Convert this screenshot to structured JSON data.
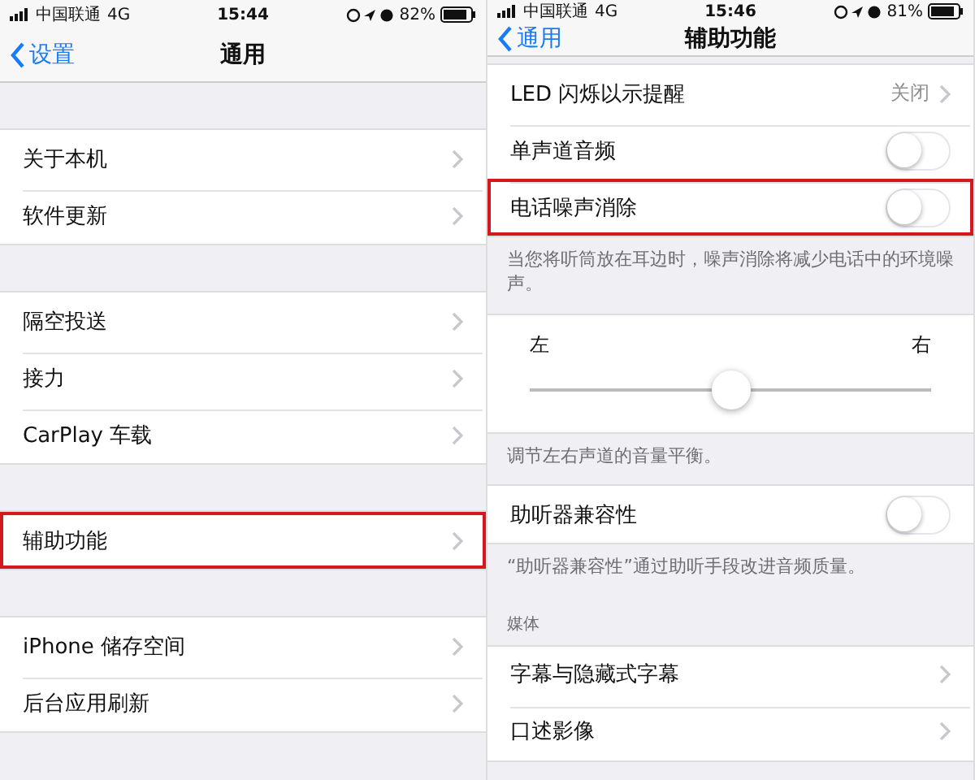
{
  "panels": [
    {
      "status_bar": {
        "carrier": "中国联通",
        "network": "4G",
        "time": "15:44",
        "battery": "82%"
      },
      "nav": {
        "back": "设置",
        "title": "通用"
      },
      "groups": [
        {
          "items": [
            {
              "kind": "link",
              "label": "关于本机",
              "highlighted": false
            },
            {
              "kind": "link",
              "label": "软件更新",
              "highlighted": false
            }
          ]
        },
        {
          "items": [
            {
              "kind": "link",
              "label": "隔空投送",
              "highlighted": false
            },
            {
              "kind": "link",
              "label": "接力",
              "highlighted": false
            },
            {
              "kind": "link",
              "label": "CarPlay 车载",
              "highlighted": false
            }
          ]
        },
        {
          "items": [
            {
              "kind": "link",
              "label": "辅助功能",
              "highlighted": true
            }
          ]
        },
        {
          "items": [
            {
              "kind": "link",
              "label": "iPhone 储存空间",
              "highlighted": false
            },
            {
              "kind": "link",
              "label": "后台应用刷新",
              "highlighted": false
            }
          ]
        }
      ]
    },
    {
      "status_bar": {
        "carrier": "中国联通",
        "network": "4G",
        "time": "15:46",
        "battery": "81%"
      },
      "nav": {
        "back": "通用",
        "title": "辅助功能"
      },
      "groups": [
        {
          "items": [
            {
              "kind": "value",
              "label": "LED 闪烁以示提醒",
              "value": "关闭",
              "highlighted": false
            },
            {
              "kind": "switch",
              "label": "单声道音频",
              "on": false,
              "highlighted": false
            },
            {
              "kind": "switch",
              "label": "电话噪声消除",
              "on": false,
              "highlighted": true
            }
          ],
          "footer": "当您将听筒放在耳边时，噪声消除将减少电话中的环境噪声。"
        },
        {
          "items": [
            {
              "kind": "balance",
              "left": "左",
              "right": "右",
              "level": 0.5
            }
          ],
          "footer": "调节左右声道的音量平衡。"
        },
        {
          "items": [
            {
              "kind": "switch",
              "label": "助听器兼容性",
              "on": false,
              "highlighted": false
            }
          ],
          "footer": "“助听器兼容性”通过助听手段改进音频质量。"
        },
        {
          "header": "媒体",
          "items": [
            {
              "kind": "link",
              "label": "字幕与隐藏式字幕",
              "highlighted": false
            },
            {
              "kind": "link",
              "label": "口述影像",
              "highlighted": false
            }
          ]
        }
      ]
    }
  ]
}
